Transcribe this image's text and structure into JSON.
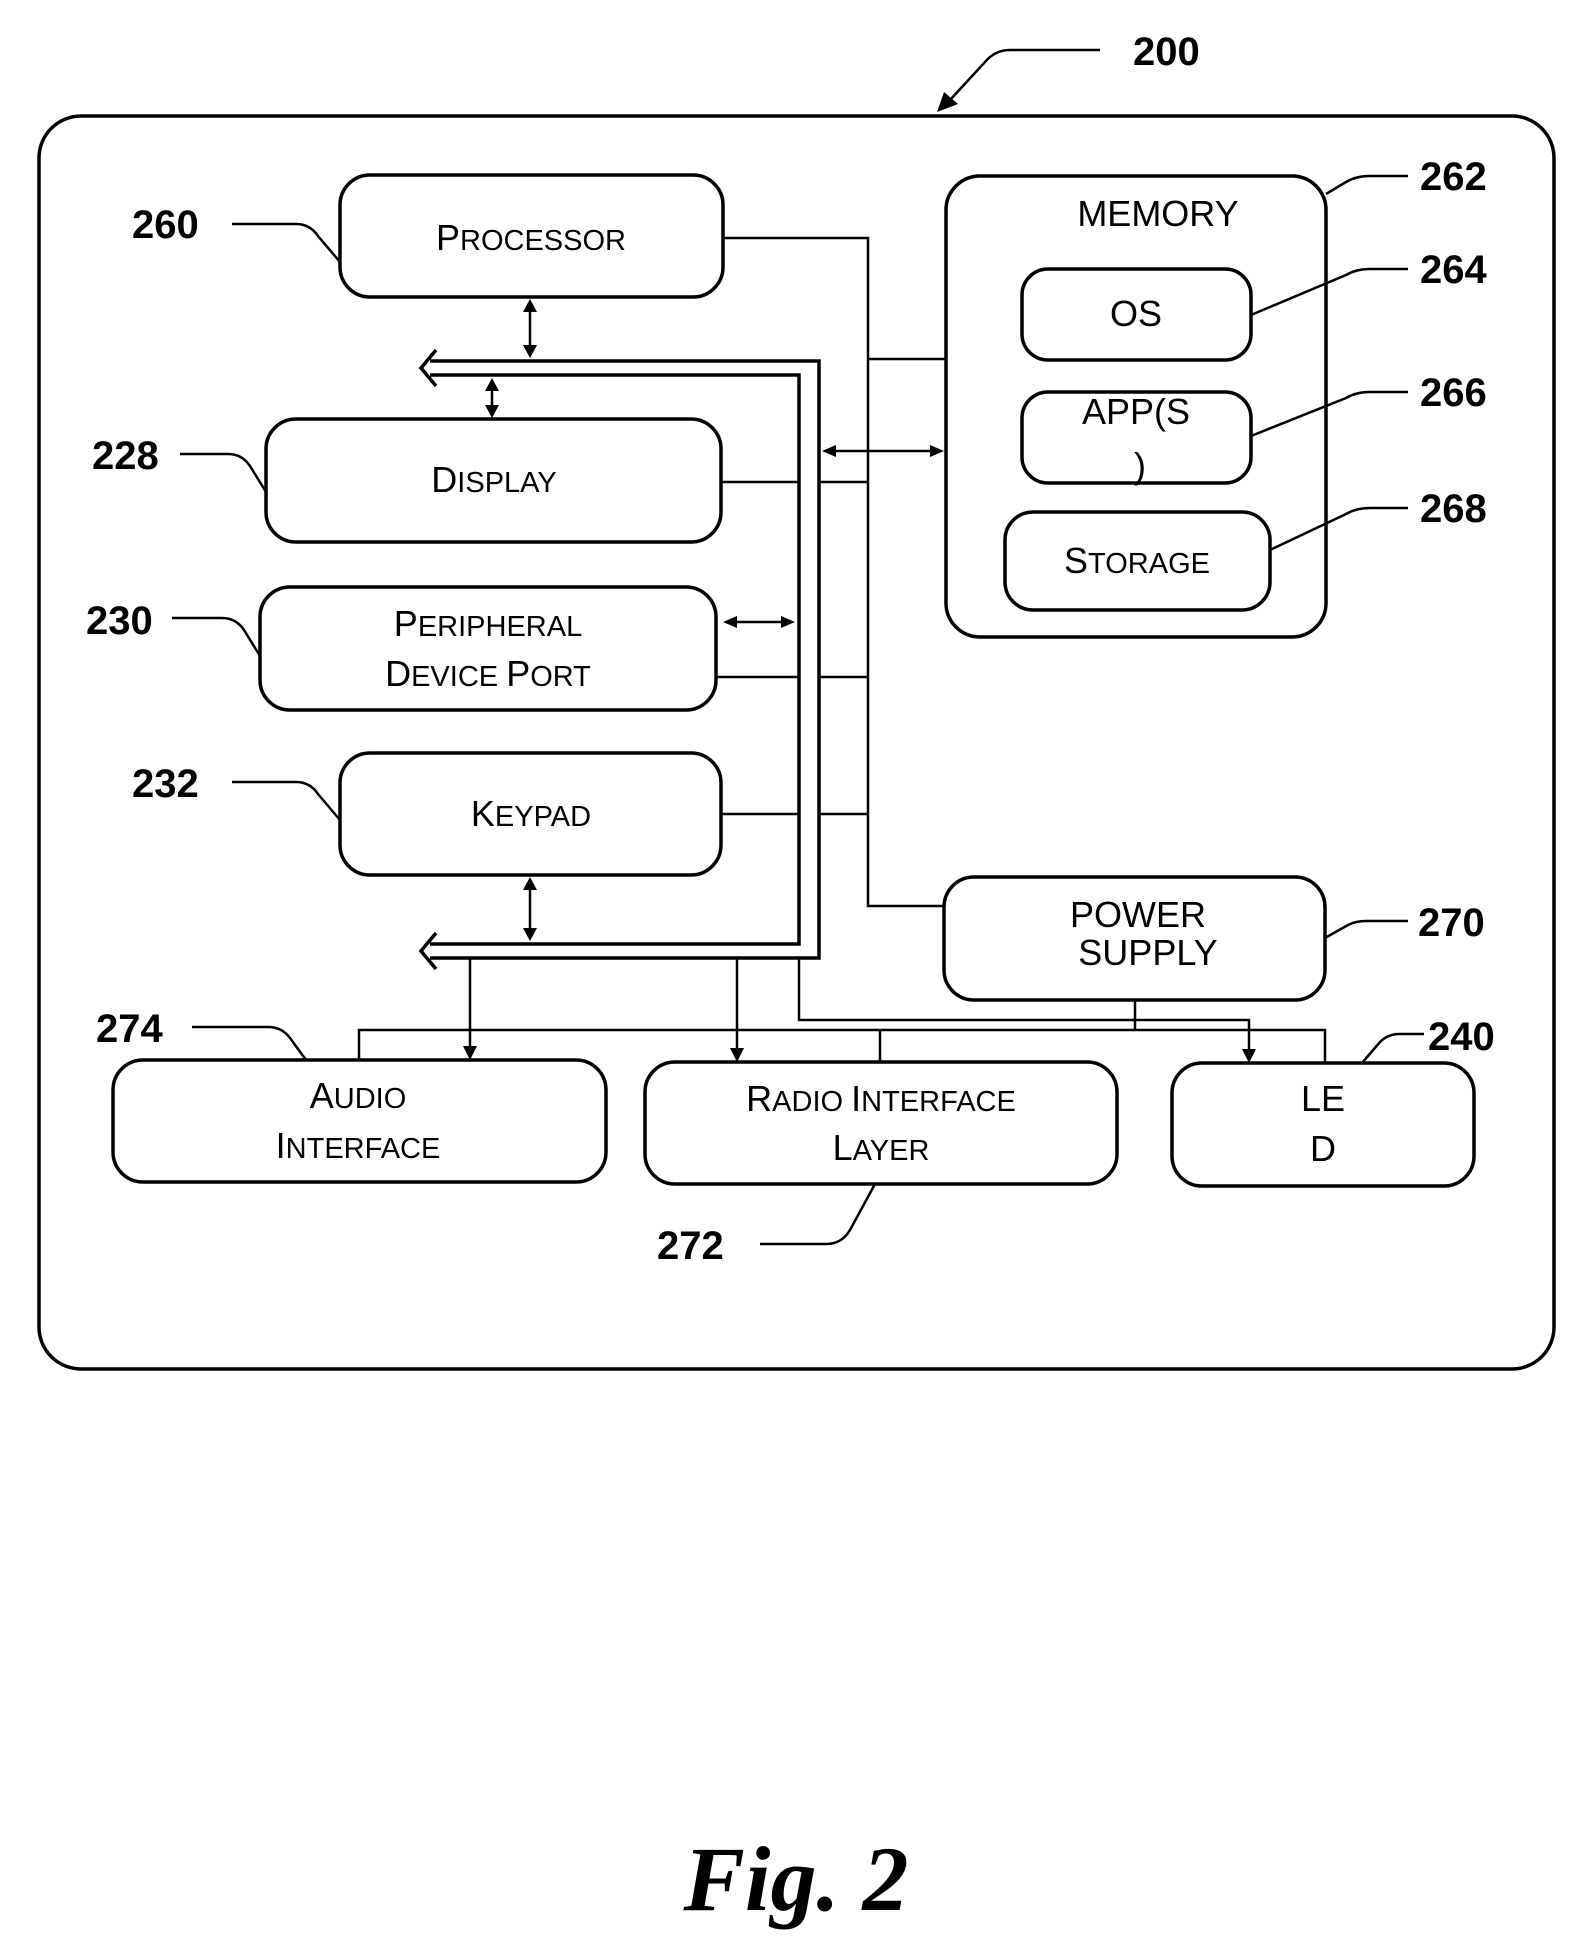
{
  "figure": {
    "caption": "Fig. 2",
    "device_ref": "200"
  },
  "blocks": {
    "processor": {
      "label_first": "P",
      "label_rest": "ROCESSOR",
      "ref": "260"
    },
    "display": {
      "label_first": "D",
      "label_rest": "ISPLAY",
      "ref": "228"
    },
    "peripheral": {
      "line1_first": "P",
      "line1_rest": "ERIPHERAL",
      "line2_first1": "D",
      "line2_rest1": "EVICE ",
      "line2_first2": "P",
      "line2_rest2": "ORT",
      "ref": "230"
    },
    "keypad": {
      "label_first": "K",
      "label_rest": "EYPAD",
      "ref": "232"
    },
    "memory": {
      "label": "MEMORY",
      "ref": "262"
    },
    "os": {
      "label": "OS",
      "ref": "264"
    },
    "apps": {
      "line1": "APP(S",
      "line2": ")",
      "ref": "266"
    },
    "storage": {
      "label_first": "S",
      "label_rest": "TORAGE",
      "ref": "268"
    },
    "power_supply": {
      "line1": "POWER",
      "line2": "SUPPLY",
      "ref": "270"
    },
    "audio_interface": {
      "line1_first": "A",
      "line1_rest": "UDIO",
      "line2_first": "I",
      "line2_rest": "NTERFACE",
      "ref": "274"
    },
    "radio_interface": {
      "line1_first1": "R",
      "line1_rest1": "ADIO ",
      "line1_first2": "I",
      "line1_rest2": "NTERFACE",
      "line2_first": "L",
      "line2_rest": "AYER",
      "ref": "272"
    },
    "led": {
      "line1": "LE",
      "line2": "D",
      "ref": "240"
    }
  }
}
